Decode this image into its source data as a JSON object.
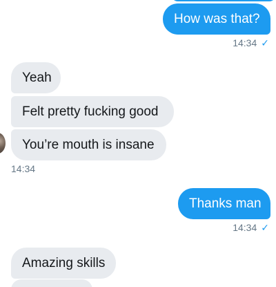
{
  "conversation": {
    "messages": [
      {
        "direction": "outgoing",
        "text": "How was that?"
      },
      {
        "direction": "incoming",
        "text": "Yeah"
      },
      {
        "direction": "incoming",
        "text": "Felt pretty fucking good"
      },
      {
        "direction": "incoming",
        "text": "You’re mouth is insane"
      },
      {
        "direction": "outgoing",
        "text": "Thanks man"
      },
      {
        "direction": "incoming",
        "text": "Amazing skills"
      }
    ],
    "timestamps": {
      "first_outgoing": "14:34",
      "incoming_group": "14:34",
      "second_outgoing": "14:34"
    },
    "read_mark": "✓",
    "colors": {
      "outgoing_bubble": "#1d9bf0",
      "incoming_bubble": "#e8ebef",
      "timestamp_text": "#657786"
    }
  }
}
